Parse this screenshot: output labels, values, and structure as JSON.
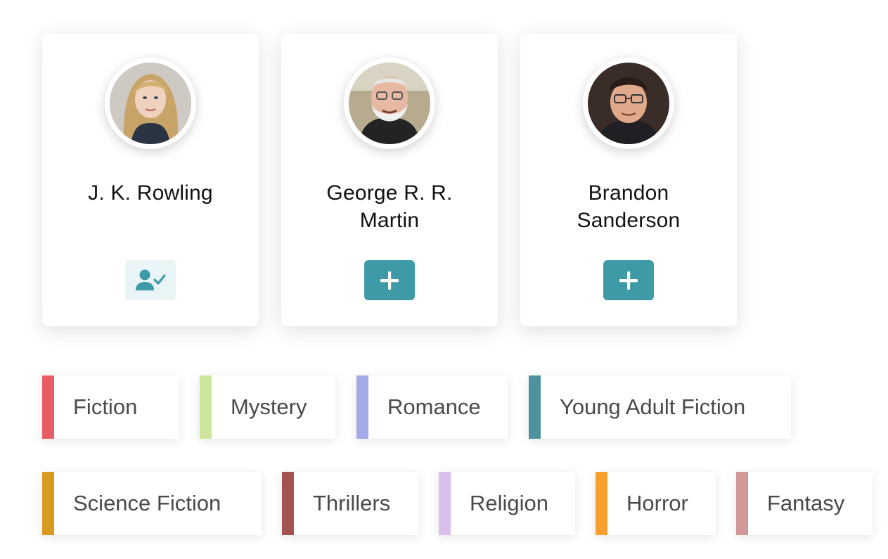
{
  "authors": [
    {
      "name": "J. K. Rowling",
      "action": "followed",
      "action_icon": "user-check-icon"
    },
    {
      "name": "George R. R. Martin",
      "action": "add",
      "action_icon": "plus-icon"
    },
    {
      "name": "Brandon Sanderson",
      "action": "add",
      "action_icon": "plus-icon"
    }
  ],
  "genres": {
    "row1": [
      {
        "label": "Fiction",
        "color": "#e85d63"
      },
      {
        "label": "Mystery",
        "color": "#cde69a"
      },
      {
        "label": "Romance",
        "color": "#a3aae8"
      },
      {
        "label": "Young Adult Fiction",
        "color": "#4d939e"
      }
    ],
    "row2": [
      {
        "label": "Science Fiction",
        "color": "#d99a22"
      },
      {
        "label": "Thrillers",
        "color": "#a45353"
      },
      {
        "label": "Religion",
        "color": "#d8c0ea"
      },
      {
        "label": "Horror",
        "color": "#f7a02e"
      },
      {
        "label": "Fantasy",
        "color": "#d29898"
      }
    ]
  },
  "colors": {
    "accent": "#3f9aa8",
    "accent_light": "#e8f4f6"
  }
}
